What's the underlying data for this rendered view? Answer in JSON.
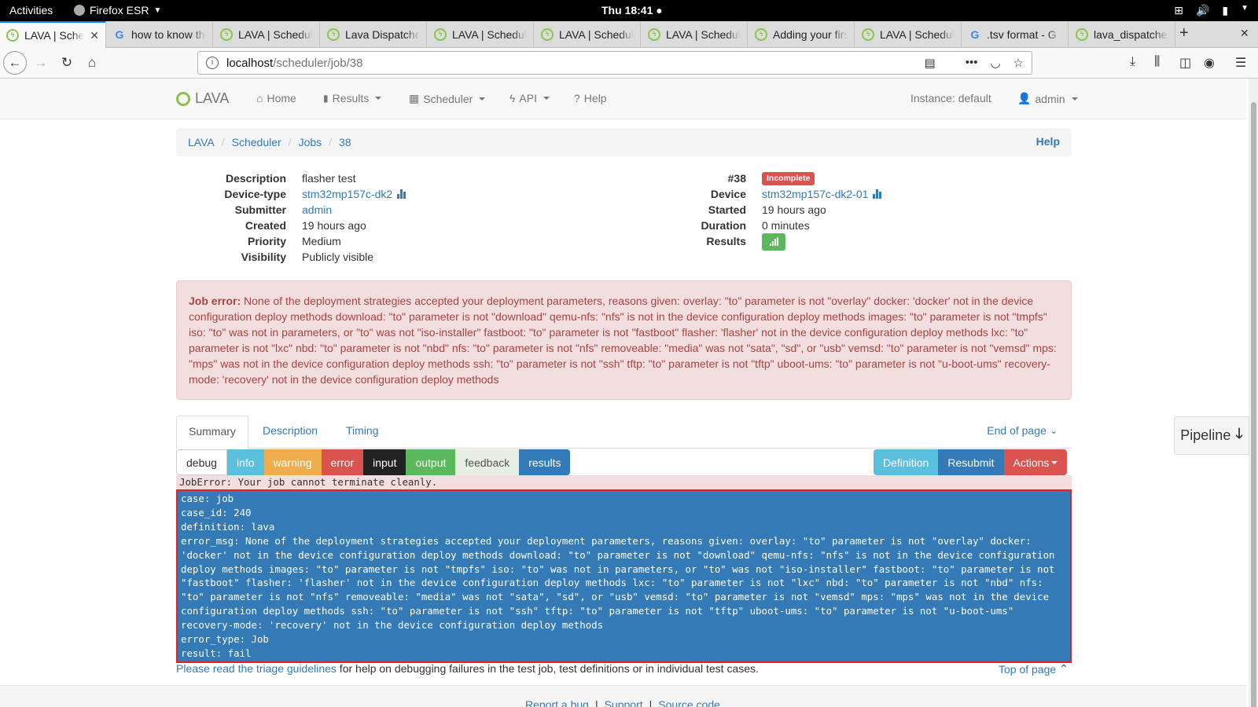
{
  "os_bar": {
    "activities": "Activities",
    "app_name": "Firefox ESR",
    "clock": "Thu 18:41"
  },
  "browser": {
    "tabs": [
      {
        "title": "LAVA | Scheduler",
        "favicon": "lava",
        "active": true
      },
      {
        "title": "how to know the",
        "favicon": "google"
      },
      {
        "title": "LAVA | Scheduler",
        "favicon": "lava"
      },
      {
        "title": "Lava Dispatcher",
        "favicon": "lava"
      },
      {
        "title": "LAVA | Scheduler",
        "favicon": "lava"
      },
      {
        "title": "LAVA | Scheduler",
        "favicon": "lava"
      },
      {
        "title": "LAVA | Scheduler",
        "favicon": "lava"
      },
      {
        "title": "Adding your first",
        "favicon": "lava"
      },
      {
        "title": "LAVA | Scheduler",
        "favicon": "lava"
      },
      {
        "title": ".tsv format - G",
        "favicon": "google"
      },
      {
        "title": "lava_dispatcher",
        "favicon": "lava"
      }
    ],
    "url_host": "localhost",
    "url_path": "/scheduler/job/38"
  },
  "lava_nav": {
    "brand": "LAVA",
    "home": "Home",
    "results": "Results",
    "scheduler": "Scheduler",
    "api": "API",
    "help": "Help",
    "instance": "Instance: default",
    "user": "admin"
  },
  "breadcrumb": {
    "items": [
      "LAVA",
      "Scheduler",
      "Jobs",
      "38"
    ],
    "help": "Help"
  },
  "job": {
    "left": [
      {
        "key": "Description",
        "value": "flasher test"
      },
      {
        "key": "Device-type",
        "value": "stm32mp157c-dk2"
      },
      {
        "key": "Submitter",
        "value": "admin"
      },
      {
        "key": "Created",
        "value": "19 hours ago"
      },
      {
        "key": "Priority",
        "value": "Medium"
      },
      {
        "key": "Visibility",
        "value": "Publicly visible"
      }
    ],
    "id": "#38",
    "status": "Incomplete",
    "right": [
      {
        "key": "Device",
        "value": "stm32mp157c-dk2-01"
      },
      {
        "key": "Started",
        "value": "19 hours ago"
      },
      {
        "key": "Duration",
        "value": "0 minutes"
      },
      {
        "key": "Results",
        "value": ""
      }
    ]
  },
  "job_error": {
    "label": "Job error:",
    "text": "None of the deployment strategies accepted your deployment parameters, reasons given: overlay: \"to\" parameter is not \"overlay\" docker: 'docker' not in the device configuration deploy methods download: \"to\" parameter is not \"download\" qemu-nfs: \"nfs\" is not in the device configuration deploy methods images: \"to\" parameter is not \"tmpfs\" iso: \"to\" was not in parameters, or \"to\" was not \"iso-installer\" fastboot: \"to\" parameter is not \"fastboot\" flasher: 'flasher' not in the device configuration deploy methods lxc: \"to\" parameter is not \"lxc\" nbd: \"to\" parameter is not \"nbd\" nfs: \"to\" parameter is not \"nfs\" removeable: \"media\" was not \"sata\", \"sd\", or \"usb\" vemsd: \"to\" parameter is not \"vemsd\" mps: \"mps\" was not in the device configuration deploy methods ssh: \"to\" parameter is not \"ssh\" tftp: \"to\" parameter is not \"tftp\" uboot-ums: \"to\" parameter is not \"u-boot-ums\" recovery-mode: 'recovery' not in the device configuration deploy methods"
  },
  "tabs": {
    "summary": "Summary",
    "description": "Description",
    "timing": "Timing",
    "end_of_page": "End of page"
  },
  "levels": [
    {
      "label": "debug",
      "bg": "#ffffff",
      "fg": "#333333"
    },
    {
      "label": "info",
      "bg": "#5bc0de",
      "fg": "#ffffff"
    },
    {
      "label": "warning",
      "bg": "#f0ad4e",
      "fg": "#ffffff"
    },
    {
      "label": "error",
      "bg": "#d9534f",
      "fg": "#ffffff"
    },
    {
      "label": "input",
      "bg": "#222222",
      "fg": "#ffffff"
    },
    {
      "label": "output",
      "bg": "#5cb85c",
      "fg": "#ffffff"
    },
    {
      "label": "feedback",
      "bg": "#e6efe2",
      "fg": "#555555"
    },
    {
      "label": "results",
      "bg": "#337ab7",
      "fg": "#ffffff"
    }
  ],
  "actions": {
    "definition": "Definition",
    "resubmit": "Resubmit",
    "actions": "Actions"
  },
  "pipeline": "Pipeline",
  "log": {
    "error_line": "JobError: Your job cannot terminate cleanly.",
    "result_block": "case: job\ncase_id: 240\ndefinition: lava\nerror_msg: None of the deployment strategies accepted your deployment parameters, reasons given: overlay: \"to\" parameter is not \"overlay\" docker: 'docker' not in the device configuration deploy methods download: \"to\" parameter is not \"download\" qemu-nfs: \"nfs\" is not in the device configuration deploy methods images: \"to\" parameter is not \"tmpfs\" iso: \"to\" was not in parameters, or \"to\" was not \"iso-installer\" fastboot: \"to\" parameter is not \"fastboot\" flasher: 'flasher' not in the device configuration deploy methods lxc: \"to\" parameter is not \"lxc\" nbd: \"to\" parameter is not \"nbd\" nfs: \"to\" parameter is not \"nfs\" removeable: \"media\" was not \"sata\", \"sd\", or \"usb\" vemsd: \"to\" parameter is not \"vemsd\" mps: \"mps\" was not in the device configuration deploy methods ssh: \"to\" parameter is not \"ssh\" tftp: \"to\" parameter is not \"tftp\" uboot-ums: \"to\" parameter is not \"u-boot-ums\" recovery-mode: 'recovery' not in the device configuration deploy methods\nerror_type: Job\nresult: fail"
  },
  "triage": {
    "link": "Please read the triage guidelines",
    "rest": " for help on debugging failures in the test job, test definitions or in individual test cases.",
    "top_of_page": "Top of page"
  },
  "footer": {
    "report_bug": "Report a bug",
    "support": "Support",
    "source_code": "Source code"
  }
}
